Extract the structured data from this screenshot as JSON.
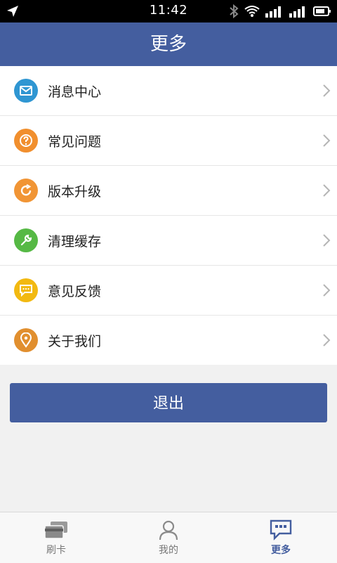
{
  "status": {
    "time": "11:42",
    "icons": [
      "location-arrow-icon",
      "bluetooth-icon",
      "wifi-icon",
      "signal-icon",
      "signal-2-icon",
      "battery-icon"
    ]
  },
  "appbar": {
    "title": "更多"
  },
  "menu": {
    "items": [
      {
        "label": "消息中心",
        "icon": "mail-icon",
        "color": "#2f96d2"
      },
      {
        "label": "常见问题",
        "icon": "question-icon",
        "color": "#f18f2e"
      },
      {
        "label": "版本升级",
        "icon": "refresh-icon",
        "color": "#f19535"
      },
      {
        "label": "清理缓存",
        "icon": "wrench-icon",
        "color": "#56b945"
      },
      {
        "label": "意见反馈",
        "icon": "chat-icon",
        "color": "#f2b911"
      },
      {
        "label": "关于我们",
        "icon": "location-pin-icon",
        "color": "#e18f2f"
      }
    ]
  },
  "logout": {
    "label": "退出"
  },
  "bottomnav": {
    "tabs": [
      {
        "label": "刷卡",
        "icon": "card-icon",
        "active": false
      },
      {
        "label": "我的",
        "icon": "user-icon",
        "active": false
      },
      {
        "label": "更多",
        "icon": "more-chat-icon",
        "active": true
      }
    ]
  }
}
